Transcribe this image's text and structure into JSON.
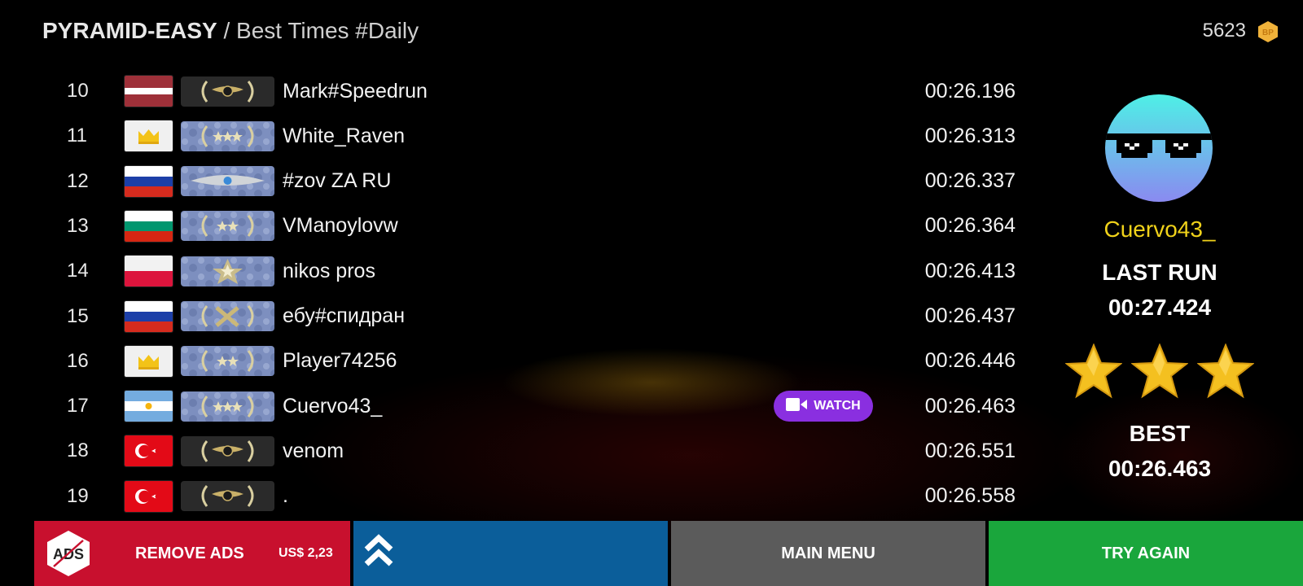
{
  "header": {
    "mode": "PYRAMID-EASY",
    "subtitle": " / Best Times #Daily"
  },
  "coins": {
    "amount": "5623",
    "icon": "hexagon-coin-icon",
    "color": "#f0b23a"
  },
  "leaderboard": [
    {
      "rank": "10",
      "flag": "latvia",
      "badge": "gold-eagle",
      "name": "Mark#Speedrun",
      "time": "00:26.196",
      "watch": false
    },
    {
      "rank": "11",
      "flag": "crown",
      "badge": "three-stars-laurel",
      "name": "White_Raven",
      "time": "00:26.313",
      "watch": false
    },
    {
      "rank": "12",
      "flag": "russia",
      "badge": "silver-wings",
      "name": "#zov ZA RU",
      "time": "00:26.337",
      "watch": false
    },
    {
      "rank": "13",
      "flag": "bulgaria",
      "badge": "two-stars-laurel",
      "name": "VManoylovw",
      "time": "00:26.364",
      "watch": false
    },
    {
      "rank": "14",
      "flag": "poland",
      "badge": "star-emblem",
      "name": "nikos pros",
      "time": "00:26.413",
      "watch": false
    },
    {
      "rank": "15",
      "flag": "russia",
      "badge": "crossed-guns",
      "name": "ебу#спидран",
      "time": "00:26.437",
      "watch": false
    },
    {
      "rank": "16",
      "flag": "crown",
      "badge": "two-stars-laurel",
      "name": "Player74256",
      "time": "00:26.446",
      "watch": false
    },
    {
      "rank": "17",
      "flag": "argentina",
      "badge": "three-stars-laurel",
      "name": "Cuervo43_",
      "time": "00:26.463",
      "watch": true
    },
    {
      "rank": "18",
      "flag": "turkey",
      "badge": "gold-eagle",
      "name": "venom",
      "time": "00:26.551",
      "watch": false
    },
    {
      "rank": "19",
      "flag": "turkey",
      "badge": "gold-eagle",
      "name": ".",
      "time": "00:26.558",
      "watch": false
    }
  ],
  "watch_label": "WATCH",
  "player": {
    "name": "Cuervo43_",
    "avatar": "sunglasses-avatar-icon",
    "last_run_label": "LAST RUN",
    "last_run_time": "00:27.424",
    "stars": 3,
    "best_label": "BEST",
    "best_time": "00:26.463"
  },
  "bottom_bar": {
    "remove_ads_icon": "ADS",
    "remove_ads_label": "REMOVE ADS",
    "remove_ads_price": "US$ 2,23",
    "up_icon": "double-chevron-up-icon",
    "main_menu_label": "MAIN MENU",
    "try_again_label": "TRY AGAIN"
  },
  "colors": {
    "name_highlight": "#f0d21a",
    "watch_button": "#8a2fe0",
    "remove_ads": "#c8102e",
    "scroll_up": "#0b5e9a",
    "main_menu": "#5b5b5b",
    "try_again": "#1aa63c"
  }
}
